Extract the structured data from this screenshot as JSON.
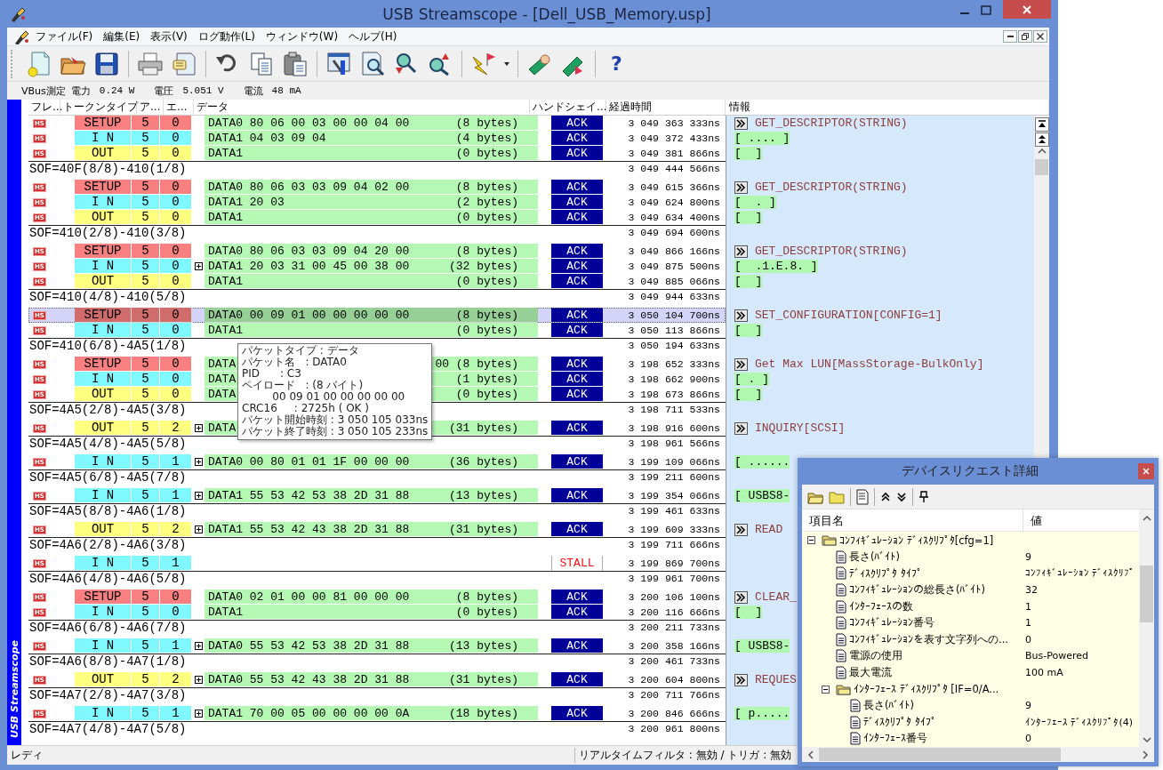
{
  "window": {
    "title": "USB Streamscope - [Dell_USB_Memory.usp]"
  },
  "menu": [
    "ファイル(F)",
    "編集(E)",
    "表示(V)",
    "ログ動作(L)",
    "ウィンドウ(W)",
    "ヘルプ(H)"
  ],
  "toolbar": {
    "help_glyph": "?"
  },
  "vbus": {
    "label": "VBus測定",
    "readings": [
      {
        "name": "電力",
        "value": "0.24 W"
      },
      {
        "name": "電圧",
        "value": "5.051 V"
      },
      {
        "name": "電流",
        "value": "48 mA"
      }
    ]
  },
  "side_label": "USB Streamscope",
  "columns": [
    "フレ…",
    "トークンタイプ",
    "ア…",
    "エ…",
    "データ",
    "ハンドシェイ…",
    "経過時間",
    "情報"
  ],
  "rows": [
    {
      "kind": "packet",
      "speed": "HS",
      "token": {
        "text": "SETUP",
        "kind": "setup"
      },
      "addr": "5",
      "endp": "0",
      "expandable": false,
      "data": "DATA0 80 06 00 03 00 00 04 00",
      "length": "(8 bytes)",
      "handshake": {
        "text": "ACK",
        "kind": "ack"
      },
      "time": "3 049 363 333ns",
      "selected": false,
      "info": {
        "kind": "request",
        "text": "GET_DESCRIPTOR(STRING)"
      }
    },
    {
      "kind": "packet",
      "speed": "HS",
      "token": {
        "text": "I N",
        "kind": "in"
      },
      "addr": "5",
      "endp": "0",
      "expandable": false,
      "data": "DATA1 04 03 09 04",
      "length": "(4 bytes)",
      "handshake": {
        "text": "ACK",
        "kind": "ack"
      },
      "time": "3 049 372 433ns",
      "selected": false,
      "info": {
        "kind": "payload",
        "text": "[ .... ]"
      }
    },
    {
      "kind": "packet",
      "speed": "HS",
      "token": {
        "text": "OUT",
        "kind": "out"
      },
      "addr": "5",
      "endp": "0",
      "expandable": false,
      "data": "DATA1",
      "length": "(0 bytes)",
      "handshake": {
        "text": "ACK",
        "kind": "ack"
      },
      "time": "3 049 381 866ns",
      "selected": false,
      "info": {
        "kind": "payload",
        "text": "[  ]"
      }
    },
    {
      "kind": "sof",
      "text": "SOF=40F(8/8)-410(1/8)",
      "time": "3 049 444 566ns"
    },
    {
      "kind": "packet",
      "speed": "HS",
      "token": {
        "text": "SETUP",
        "kind": "setup"
      },
      "addr": "5",
      "endp": "0",
      "expandable": false,
      "data": "DATA0 80 06 03 03 09 04 02 00",
      "length": "(8 bytes)",
      "handshake": {
        "text": "ACK",
        "kind": "ack"
      },
      "time": "3 049 615 366ns",
      "selected": false,
      "info": {
        "kind": "request",
        "text": "GET_DESCRIPTOR(STRING)"
      }
    },
    {
      "kind": "packet",
      "speed": "HS",
      "token": {
        "text": "I N",
        "kind": "in"
      },
      "addr": "5",
      "endp": "0",
      "expandable": false,
      "data": "DATA1 20 03",
      "length": "(2 bytes)",
      "handshake": {
        "text": "ACK",
        "kind": "ack"
      },
      "time": "3 049 624 800ns",
      "selected": false,
      "info": {
        "kind": "payload",
        "text": "[  . ]"
      }
    },
    {
      "kind": "packet",
      "speed": "HS",
      "token": {
        "text": "OUT",
        "kind": "out"
      },
      "addr": "5",
      "endp": "0",
      "expandable": false,
      "data": "DATA1",
      "length": "(0 bytes)",
      "handshake": {
        "text": "ACK",
        "kind": "ack"
      },
      "time": "3 049 634 400ns",
      "selected": false,
      "info": {
        "kind": "payload",
        "text": "[  ]"
      }
    },
    {
      "kind": "sof",
      "text": "SOF=410(2/8)-410(3/8)",
      "time": "3 049 694 600ns"
    },
    {
      "kind": "packet",
      "speed": "HS",
      "token": {
        "text": "SETUP",
        "kind": "setup"
      },
      "addr": "5",
      "endp": "0",
      "expandable": false,
      "data": "DATA0 80 06 03 03 09 04 20 00",
      "length": "(8 bytes)",
      "handshake": {
        "text": "ACK",
        "kind": "ack"
      },
      "time": "3 049 866 166ns",
      "selected": false,
      "info": {
        "kind": "request",
        "text": "GET_DESCRIPTOR(STRING)"
      }
    },
    {
      "kind": "packet",
      "speed": "HS",
      "token": {
        "text": "I N",
        "kind": "in"
      },
      "addr": "5",
      "endp": "0",
      "expandable": true,
      "data": "DATA1 20 03 31 00 45 00 38 00",
      "length": "(32 bytes)",
      "handshake": {
        "text": "ACK",
        "kind": "ack"
      },
      "time": "3 049 875 500ns",
      "selected": false,
      "info": {
        "kind": "payload",
        "text": "[  .1.E.8. ]"
      }
    },
    {
      "kind": "packet",
      "speed": "HS",
      "token": {
        "text": "OUT",
        "kind": "out"
      },
      "addr": "5",
      "endp": "0",
      "expandable": false,
      "data": "DATA1",
      "length": "(0 bytes)",
      "handshake": {
        "text": "ACK",
        "kind": "ack"
      },
      "time": "3 049 885 066ns",
      "selected": false,
      "info": {
        "kind": "payload",
        "text": "[  ]"
      }
    },
    {
      "kind": "sof",
      "text": "SOF=410(4/8)-410(5/8)",
      "time": "3 049 944 633ns"
    },
    {
      "kind": "packet",
      "speed": "HS",
      "token": {
        "text": "SETUP",
        "kind": "setup"
      },
      "addr": "5",
      "endp": "0",
      "expandable": false,
      "data": "DATA0 00 09 01 00 00 00 00 00",
      "length": "(8 bytes)",
      "handshake": {
        "text": "ACK",
        "kind": "ack"
      },
      "time": "3 050 104 700ns",
      "selected": true,
      "info": {
        "kind": "request",
        "text": "SET_CONFIGURATION[CONFIG=1]"
      }
    },
    {
      "kind": "packet",
      "speed": "HS",
      "token": {
        "text": "I N",
        "kind": "in"
      },
      "addr": "5",
      "endp": "0",
      "expandable": false,
      "data": "DATA1",
      "length": "(0 bytes)",
      "handshake": {
        "text": "ACK",
        "kind": "ack"
      },
      "time": "3 050 113 866ns",
      "selected": false,
      "info": {
        "kind": "payload",
        "text": "[  ]"
      }
    },
    {
      "kind": "sof",
      "text": "SOF=410(6/8)-4A5(1/8)",
      "time": "3 050 194 633ns"
    },
    {
      "kind": "packet",
      "speed": "HS",
      "token": {
        "text": "SETUP",
        "kind": "setup"
      },
      "addr": "5",
      "endp": "0",
      "expandable": false,
      "data": "DATA",
      "length": "00 (8 bytes)",
      "handshake": {
        "text": "ACK",
        "kind": "ack"
      },
      "time": "3 198 652 333ns",
      "selected": false,
      "info": {
        "kind": "request",
        "text": "Get Max LUN[MassStorage-BulkOnly]"
      }
    },
    {
      "kind": "packet",
      "speed": "HS",
      "token": {
        "text": "I N",
        "kind": "in"
      },
      "addr": "5",
      "endp": "0",
      "expandable": false,
      "data": "DATA",
      "length": "(1 bytes)",
      "handshake": {
        "text": "ACK",
        "kind": "ack"
      },
      "time": "3 198 662 900ns",
      "selected": false,
      "info": {
        "kind": "payload",
        "text": "[ . ]"
      }
    },
    {
      "kind": "packet",
      "speed": "HS",
      "token": {
        "text": "OUT",
        "kind": "out"
      },
      "addr": "5",
      "endp": "0",
      "expandable": false,
      "data": "DATA",
      "length": "(0 bytes)",
      "handshake": {
        "text": "ACK",
        "kind": "ack"
      },
      "time": "3 198 673 866ns",
      "selected": false,
      "info": {
        "kind": "payload",
        "text": "[  ]"
      }
    },
    {
      "kind": "sof",
      "text": "SOF=4A5(2/8)-4A5(3/8)",
      "time": "3 198 711 533ns"
    },
    {
      "kind": "packet",
      "speed": "HS",
      "token": {
        "text": "OUT",
        "kind": "out"
      },
      "addr": "5",
      "endp": "2",
      "expandable": true,
      "data": "DATA",
      "length": "(31 bytes)",
      "handshake": {
        "text": "ACK",
        "kind": "ack"
      },
      "time": "3 198 916 600ns",
      "selected": false,
      "info": {
        "kind": "request",
        "text": "INQUIRY[SCSI]"
      }
    },
    {
      "kind": "sof",
      "text": "SOF=4A5(4/8)-4A5(5/8)",
      "time": "3 198 961 566ns"
    },
    {
      "kind": "packet",
      "speed": "HS",
      "token": {
        "text": "I N",
        "kind": "in"
      },
      "addr": "5",
      "endp": "1",
      "expandable": true,
      "data": "DATA0 00 80 01 01 1F 00 00 00",
      "length": "(36 bytes)",
      "handshake": {
        "text": "ACK",
        "kind": "ack"
      },
      "time": "3 199 109 066ns",
      "selected": false,
      "info": {
        "kind": "payload",
        "text": "[ ......"
      }
    },
    {
      "kind": "sof",
      "text": "SOF=4A5(6/8)-4A5(7/8)",
      "time": "3 199 211 600ns"
    },
    {
      "kind": "packet",
      "speed": "HS",
      "token": {
        "text": "I N",
        "kind": "in"
      },
      "addr": "5",
      "endp": "1",
      "expandable": true,
      "data": "DATA1 55 53 42 53 38 2D 31 88",
      "length": "(13 bytes)",
      "handshake": {
        "text": "ACK",
        "kind": "ack"
      },
      "time": "3 199 354 066ns",
      "selected": false,
      "info": {
        "kind": "payload",
        "text": "[ USBS8-"
      }
    },
    {
      "kind": "sof",
      "text": "SOF=4A5(8/8)-4A6(1/8)",
      "time": "3 199 461 633ns"
    },
    {
      "kind": "packet",
      "speed": "HS",
      "token": {
        "text": "OUT",
        "kind": "out"
      },
      "addr": "5",
      "endp": "2",
      "expandable": true,
      "data": "DATA1 55 53 42 43 38 2D 31 88",
      "length": "(31 bytes)",
      "handshake": {
        "text": "ACK",
        "kind": "ack"
      },
      "time": "3 199 609 333ns",
      "selected": false,
      "info": {
        "kind": "request",
        "text": "READ"
      }
    },
    {
      "kind": "sof",
      "text": "SOF=4A6(2/8)-4A6(3/8)",
      "time": "3 199 711 666ns"
    },
    {
      "kind": "packet",
      "speed": "HS",
      "token": {
        "text": "I N",
        "kind": "in"
      },
      "addr": "5",
      "endp": "1",
      "expandable": false,
      "handshake": {
        "text": "STALL",
        "kind": "stall"
      },
      "time": "3 199 869 700ns",
      "selected": false
    },
    {
      "kind": "sof",
      "text": "SOF=4A6(4/8)-4A6(5/8)",
      "time": "3 199 961 700ns"
    },
    {
      "kind": "packet",
      "speed": "HS",
      "token": {
        "text": "SETUP",
        "kind": "setup"
      },
      "addr": "5",
      "endp": "0",
      "expandable": false,
      "data": "DATA0 02 01 00 00 81 00 00 00",
      "length": "(8 bytes)",
      "handshake": {
        "text": "ACK",
        "kind": "ack"
      },
      "time": "3 200 106 100ns",
      "selected": false,
      "info": {
        "kind": "request",
        "text": "CLEAR_"
      }
    },
    {
      "kind": "packet",
      "speed": "HS",
      "token": {
        "text": "I N",
        "kind": "in"
      },
      "addr": "5",
      "endp": "0",
      "expandable": false,
      "data": "DATA1",
      "length": "(0 bytes)",
      "handshake": {
        "text": "ACK",
        "kind": "ack"
      },
      "time": "3 200 116 666ns",
      "selected": false,
      "info": {
        "kind": "payload",
        "text": "[  ]"
      }
    },
    {
      "kind": "sof",
      "text": "SOF=4A6(6/8)-4A6(7/8)",
      "time": "3 200 211 733ns"
    },
    {
      "kind": "packet",
      "speed": "HS",
      "token": {
        "text": "I N",
        "kind": "in"
      },
      "addr": "5",
      "endp": "1",
      "expandable": true,
      "data": "DATA0 55 53 42 53 38 2D 31 88",
      "length": "(13 bytes)",
      "handshake": {
        "text": "ACK",
        "kind": "ack"
      },
      "time": "3 200 358 166ns",
      "selected": false,
      "info": {
        "kind": "payload",
        "text": "[ USBS8-"
      }
    },
    {
      "kind": "sof",
      "text": "SOF=4A6(8/8)-4A7(1/8)",
      "time": "3 200 461 733ns"
    },
    {
      "kind": "packet",
      "speed": "HS",
      "token": {
        "text": "OUT",
        "kind": "out"
      },
      "addr": "5",
      "endp": "2",
      "expandable": true,
      "data": "DATA0 55 53 42 43 38 2D 31 88",
      "length": "(31 bytes)",
      "handshake": {
        "text": "ACK",
        "kind": "ack"
      },
      "time": "3 200 604 800ns",
      "selected": false,
      "info": {
        "kind": "request",
        "text": "REQUES"
      }
    },
    {
      "kind": "sof",
      "text": "SOF=4A7(2/8)-4A7(3/8)",
      "time": "3 200 711 766ns"
    },
    {
      "kind": "packet",
      "speed": "HS",
      "token": {
        "text": "I N",
        "kind": "in"
      },
      "addr": "5",
      "endp": "1",
      "expandable": true,
      "data": "DATA1 70 00 05 00 00 00 00 0A",
      "length": "(18 bytes)",
      "handshake": {
        "text": "ACK",
        "kind": "ack"
      },
      "time": "3 200 846 666ns",
      "selected": false,
      "info": {
        "kind": "payload",
        "text": "[ p....."
      }
    },
    {
      "kind": "sof",
      "text": "SOF=4A7(4/8)-4A7(5/8)",
      "time": "3 200 961 800ns"
    }
  ],
  "tooltip": {
    "lines": [
      "パケットタイプ : データ",
      "パケット名   : DATA0",
      "PID      : C3",
      "ペイロード   : (8 バイト)",
      "         00 09 01 00 00 00 00 00",
      "CRC16     : 2725h ( OK )",
      "パケット開始時刻 : 3 050 105 033ns",
      "パケット終了時刻 : 3 050 105 233ns"
    ]
  },
  "status_bar": {
    "left": "レディ",
    "right": "リアルタイムフィルタ : 無効 / トリガ : 無効"
  },
  "dialog": {
    "title": "デバイスリクエスト詳細",
    "columns": [
      "項目名",
      "値"
    ],
    "tree": [
      {
        "name": "ｺﾝﾌｨｷﾞｭﾚｰｼｮﾝ ﾃﾞｨｽｸﾘﾌﾟﾀ[cfg=1]",
        "expanded": true,
        "children": [
          {
            "name": "長さ(ﾊﾞｲﾄ)",
            "value": "9"
          },
          {
            "name": "ﾃﾞｨｽｸﾘﾌﾟﾀ ﾀｲﾌﾟ",
            "value": "ｺﾝﾌｨｷﾞｭﾚｰｼｮﾝ ﾃﾞｨｽｸﾘﾌﾟ"
          },
          {
            "name": "ｺﾝﾌｨｷﾞｭﾚｰｼｮﾝの総長さ(ﾊﾞｲﾄ)",
            "value": "32"
          },
          {
            "name": "ｲﾝﾀｰﾌｪｰｽの数",
            "value": "1"
          },
          {
            "name": "ｺﾝﾌｨｷﾞｭﾚｰｼｮﾝ番号",
            "value": "1"
          },
          {
            "name": "ｺﾝﾌｨｷﾞｭﾚｰｼｮﾝを表す文字列への...",
            "value": "0"
          },
          {
            "name": "電源の使用",
            "value": "Bus-Powered"
          },
          {
            "name": "最大電流",
            "value": "100 mA"
          },
          {
            "name": "ｲﾝﾀｰﾌｪｰｽ ﾃﾞｨｽｸﾘﾌﾟﾀ [IF=0/A...",
            "expanded": true,
            "children": [
              {
                "name": "長さ(ﾊﾞｲﾄ)",
                "value": "9"
              },
              {
                "name": "ﾃﾞｨｽｸﾘﾌﾟﾀ ﾀｲﾌﾟ",
                "value": "ｲﾝﾀｰﾌｪｰｽ ﾃﾞｨｽｸﾘﾌﾟﾀ(4)"
              },
              {
                "name": "ｲﾝﾀｰﾌｪｰｽ番号",
                "value": "0"
              }
            ]
          }
        ]
      }
    ]
  }
}
